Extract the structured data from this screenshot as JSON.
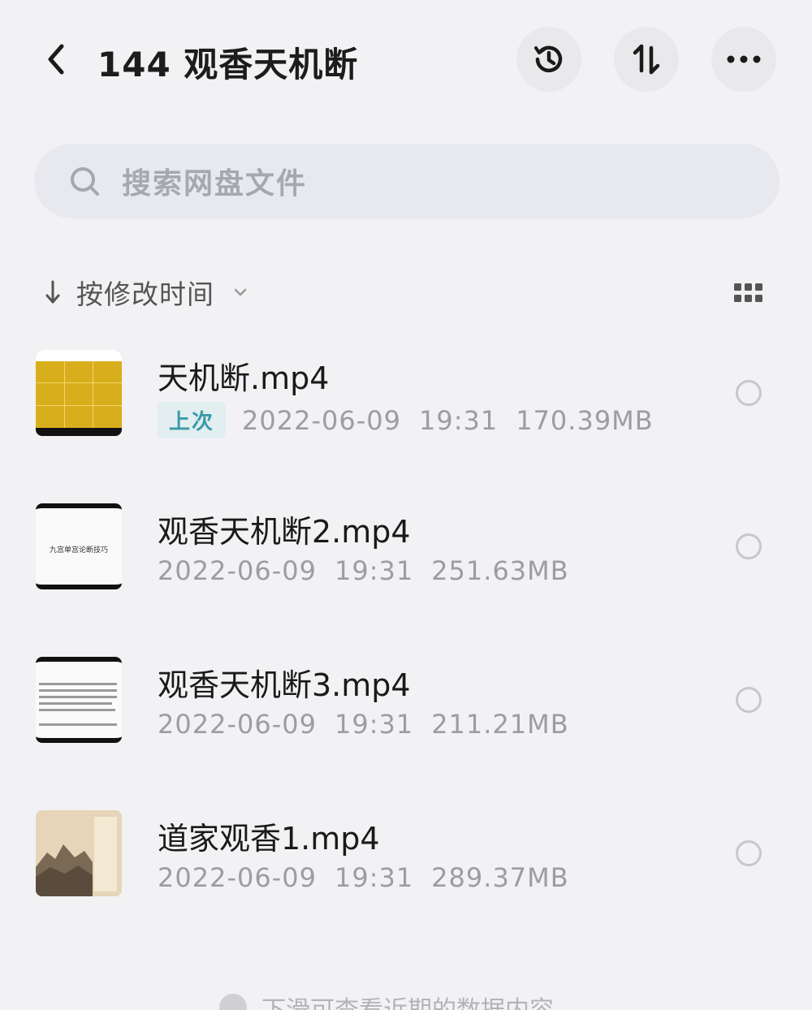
{
  "header": {
    "title": "144 观香天机断",
    "back_icon": "chevron-left-icon",
    "history_icon": "history-icon",
    "sort_icon": "sort-arrows-icon",
    "more_icon": "more-horizontal-icon"
  },
  "search": {
    "placeholder": "搜索网盘文件",
    "icon": "search-icon"
  },
  "sortbar": {
    "label": "按修改时间",
    "arrow_icon": "arrow-down-icon",
    "chevron_icon": "chevron-down-icon",
    "view_icon": "grid-view-icon"
  },
  "files": [
    {
      "name": "天机断.mp4",
      "badge": "上次",
      "date": "2022-06-09",
      "time": "19:31",
      "size": "170.39MB",
      "thumb_text": ""
    },
    {
      "name": "观香天机断2.mp4",
      "badge": "",
      "date": "2022-06-09",
      "time": "19:31",
      "size": "251.63MB",
      "thumb_text": "九宫单宫论断技巧"
    },
    {
      "name": "观香天机断3.mp4",
      "badge": "",
      "date": "2022-06-09",
      "time": "19:31",
      "size": "211.21MB",
      "thumb_text": ""
    },
    {
      "name": "道家观香1.mp4",
      "badge": "",
      "date": "2022-06-09",
      "time": "19:31",
      "size": "289.37MB",
      "thumb_text": ""
    }
  ],
  "footer": {
    "text": "下滑可查看近期的数据内容"
  },
  "colors": {
    "background": "#f2f2f4",
    "badge_text": "#3a9aa8",
    "badge_bg": "#e2eef0"
  }
}
